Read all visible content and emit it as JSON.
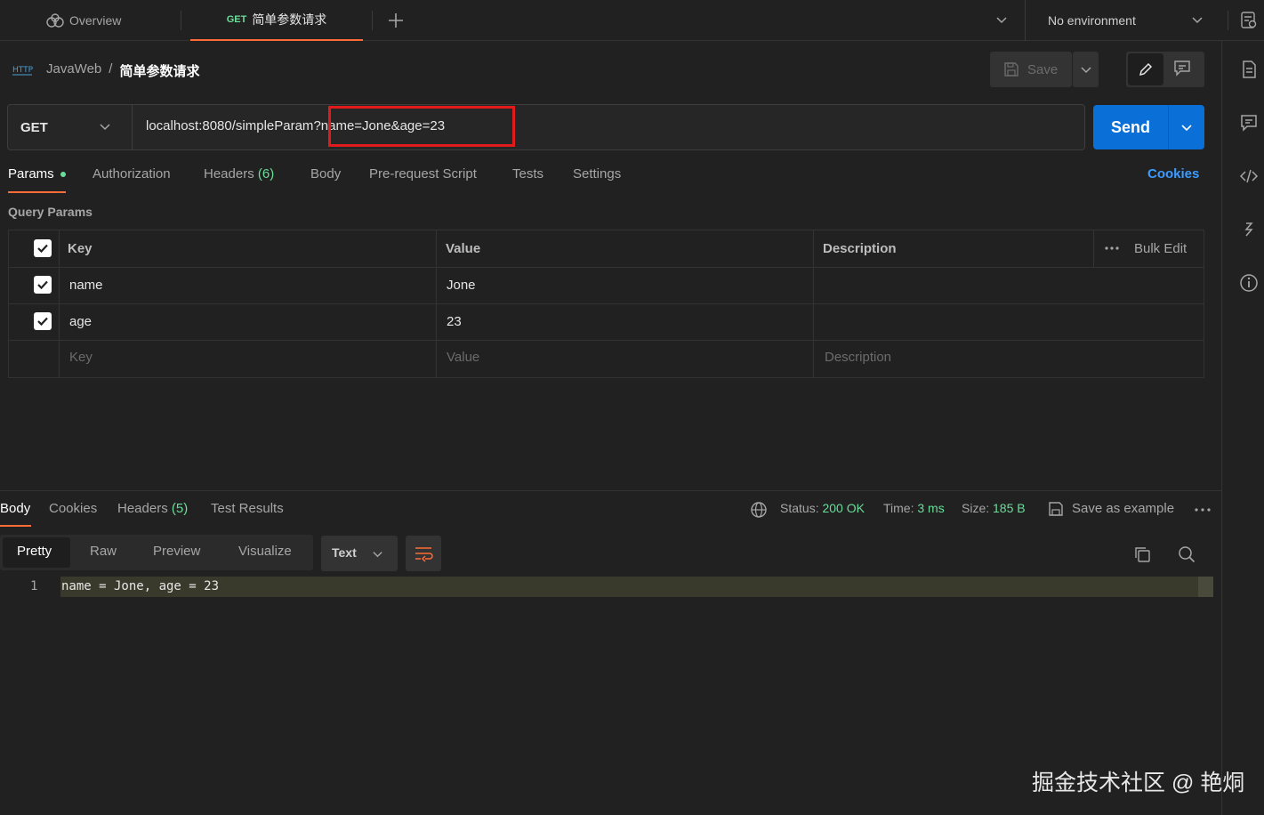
{
  "tabs": {
    "overview_label": "Overview",
    "active_method": "GET",
    "active_label": "简单参数请求",
    "environment": "No environment"
  },
  "breadcrumb": {
    "collection": "JavaWeb",
    "separator": "/",
    "request": "简单参数请求",
    "save_label": "Save"
  },
  "request": {
    "method": "GET",
    "url_base": "localhost:8080/simpleParam",
    "url_query": "?name=Jone&age=23",
    "send_label": "Send"
  },
  "req_tabs": {
    "params": "Params",
    "authorization": "Authorization",
    "headers": "Headers",
    "headers_count": "(6)",
    "body": "Body",
    "pre_request": "Pre-request Script",
    "tests": "Tests",
    "settings": "Settings",
    "cookies": "Cookies"
  },
  "query_params": {
    "section_title": "Query Params",
    "col_key": "Key",
    "col_value": "Value",
    "col_description": "Description",
    "bulk_edit": "Bulk Edit",
    "rows": [
      {
        "key": "name",
        "value": "Jone",
        "checked": true
      },
      {
        "key": "age",
        "value": "23",
        "checked": true
      }
    ],
    "placeholder_key": "Key",
    "placeholder_value": "Value",
    "placeholder_description": "Description"
  },
  "response": {
    "tabs": {
      "body": "Body",
      "cookies": "Cookies",
      "headers": "Headers",
      "headers_count": "(5)",
      "test_results": "Test Results"
    },
    "status_label": "Status:",
    "status_value": "200 OK",
    "time_label": "Time:",
    "time_value": "3 ms",
    "size_label": "Size:",
    "size_value": "185 B",
    "save_example": "Save as example",
    "formats": {
      "pretty": "Pretty",
      "raw": "Raw",
      "preview": "Preview",
      "visualize": "Visualize",
      "type": "Text"
    },
    "line_number": "1",
    "body_text": "name = Jone, age = 23"
  },
  "watermark": "掘金技术社区 @ 艳烔",
  "colors": {
    "background": "#212121",
    "accent_orange": "#ff6c37",
    "send_blue": "#0b6fd8",
    "status_green": "#6bdd9a",
    "highlight_red": "#e11b1b",
    "link_blue": "#3b9bff"
  }
}
